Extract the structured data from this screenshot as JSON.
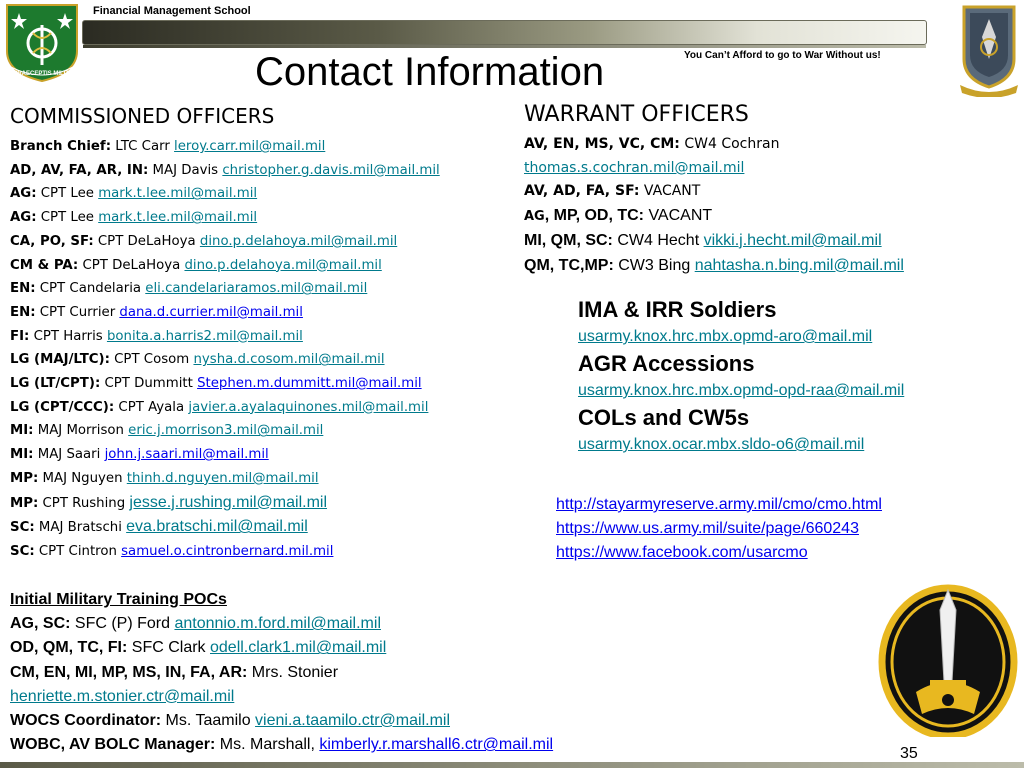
{
  "header": {
    "school_name": "Financial Management School",
    "slogan": "You Can’t Afford to go to War Without us!",
    "title": "Contact Information",
    "left_emblem_motto": "PRAECEPTIS MILITI"
  },
  "commissioned": {
    "heading": "COMMISSIONED OFFICERS",
    "rows": [
      {
        "label": "Branch Chief:",
        "name": " LTC Carr ",
        "email": "leroy.carr.mil@mail.mil"
      },
      {
        "label": "AD, AV, FA, AR, IN:",
        "name": " MAJ Davis ",
        "email": "christopher.g.davis.mil@mail.mil"
      },
      {
        "label": "AG:",
        "name": " CPT Lee ",
        "email": "mark.t.lee.mil@mail.mil"
      },
      {
        "label": "AG:",
        "name": " CPT Lee ",
        "email": "mark.t.lee.mil@mail.mil"
      },
      {
        "label": "CA, PO, SF:",
        "name": " CPT DeLaHoya ",
        "email": "dino.p.delahoya.mil@mail.mil"
      },
      {
        "label": "CM & PA:",
        "name": " CPT DeLaHoya ",
        "email": "dino.p.delahoya.mil@mail.mil"
      },
      {
        "label": "EN:",
        "name": " CPT Candelaria ",
        "email": "eli.candelariaramos.mil@mail.mil"
      },
      {
        "label": "EN:",
        "name": " CPT Currier ",
        "email": "dana.d.currier.mil@mail.mil"
      },
      {
        "label": "FI:",
        "name": " CPT Harris ",
        "email": "bonita.a.harris2.mil@mail.mil"
      },
      {
        "label": "LG (MAJ/LTC):",
        "name": " CPT Cosom ",
        "email": "nysha.d.cosom.mil@mail.mil"
      },
      {
        "label": "LG (LT/CPT):",
        "name": " CPT Dummitt ",
        "email": "Stephen.m.dummitt.mil@mail.mil"
      },
      {
        "label": "LG (CPT/CCC):",
        "name": " CPT Ayala ",
        "email": "javier.a.ayalaquinones.mil@mail.mil"
      },
      {
        "label": "MI:",
        "name": " MAJ Morrison ",
        "email": "eric.j.morrison3.mil@mail.mil"
      },
      {
        "label": "MI:",
        "name": " MAJ Saari ",
        "email": "john.j.saari.mil@mail.mil"
      },
      {
        "label": "MP:",
        "name": " MAJ Nguyen ",
        "email": "thinh.d.nguyen.mil@mail.mil"
      },
      {
        "label": "MP:",
        "name": " CPT Rushing ",
        "email": "jesse.j.rushing.mil@mail.mil"
      },
      {
        "label": "SC:",
        "name": " MAJ Bratschi ",
        "email": "eva.bratschi.mil@mail.mil"
      },
      {
        "label": "SC:",
        "name": " CPT Cintron ",
        "email": "samuel.o.cintronbernard.mil.mil"
      }
    ]
  },
  "imt": {
    "title": "Initial Military Training POCs",
    "rows": [
      {
        "label": "AG, SC:",
        "name": " SFC (P) Ford ",
        "email": "antonnio.m.ford.mil@mail.mil"
      },
      {
        "label": "OD, QM, TC, FI:",
        "name": " SFC Clark ",
        "email": "odell.clark1.mil@mail.mil"
      },
      {
        "label": "CM, EN, MI, MP, MS, IN, FA, AR:",
        "name": " Mrs. Stonier",
        "email": ""
      },
      {
        "label": "",
        "name": "",
        "email": "henriette.m.stonier.ctr@mail.mil"
      },
      {
        "label": "WOCS Coordinator:",
        "name": " Ms. Taamilo ",
        "email": "vieni.a.taamilo.ctr@mail.mil"
      },
      {
        "label": "WOBC, AV BOLC Manager:",
        "name": " Ms. Marshall, ",
        "email": "kimberly.r.marshall6.ctr@mail.mil"
      }
    ]
  },
  "warrant": {
    "heading": "WARRANT OFFICERS",
    "line1_label": "AV, EN, MS, VC, CM:",
    "line1_name": " CW4 Cochran",
    "line2_email": "thomas.s.cochran.mil@mail.mil",
    "line3_label": "AV, AD, FA, SF:",
    "line3_name": " VACANT",
    "line4_label_a": "AG",
    "line4_label_b": ", MP, OD, TC:",
    "line4_name": " VACANT",
    "line5_label": "MI, QM, SC:",
    "line5_name": " CW4 Hecht ",
    "line5_email": "vikki.j.hecht.mil@mail.mil",
    "line6_label": "QM, TC,MP:",
    "line6_name": " CW3 Bing ",
    "line6_email": "nahtasha.n.bing.mil@mail.mil"
  },
  "mailboxes": [
    {
      "heading": "IMA & IRR Soldiers",
      "email": "usarmy.knox.hrc.mbx.opmd-aro@mail.mil"
    },
    {
      "heading": "AGR Accessions",
      "email": "usarmy.knox.hrc.mbx.opmd-opd-raa@mail.mil"
    },
    {
      "heading": "COLs and CW5s",
      "email": "usarmy.knox.ocar.mbx.sldo-o6@mail.mil"
    }
  ],
  "urls": [
    "http://stayarmyreserve.army.mil/cmo/cmo.html",
    "https://www.us.army.mil/suite/page/660243",
    "https://www.facebook.com/usarcmo"
  ],
  "page_number": "35",
  "colors": {
    "link": "#0000ee",
    "teal_link": "#007a8c",
    "patch_gold": "#e8b820",
    "patch_black": "#111111"
  }
}
